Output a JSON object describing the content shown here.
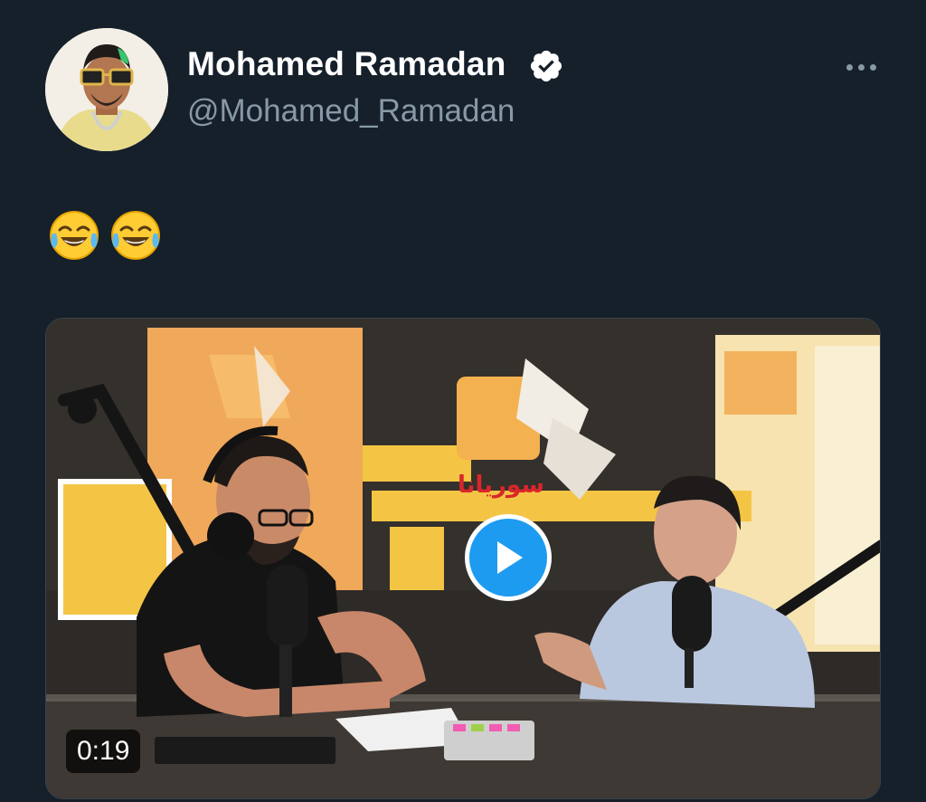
{
  "tweet": {
    "author": {
      "display_name": "Mohamed Ramadan",
      "handle": "@Mohamed_Ramadan",
      "verified": true
    },
    "text_emojis": [
      "face-with-tears-of-joy",
      "face-with-tears-of-joy"
    ],
    "media": {
      "type": "video",
      "duration": "0:19",
      "station_sign_text": "سوريانا"
    }
  },
  "colors": {
    "background": "#15202b",
    "primary_text": "#ffffff",
    "secondary_text": "#8899a6",
    "accent": "#1d9bf0"
  },
  "icons": {
    "verified": "verified-badge-icon",
    "more": "more-horizontal-icon",
    "play": "play-icon"
  }
}
